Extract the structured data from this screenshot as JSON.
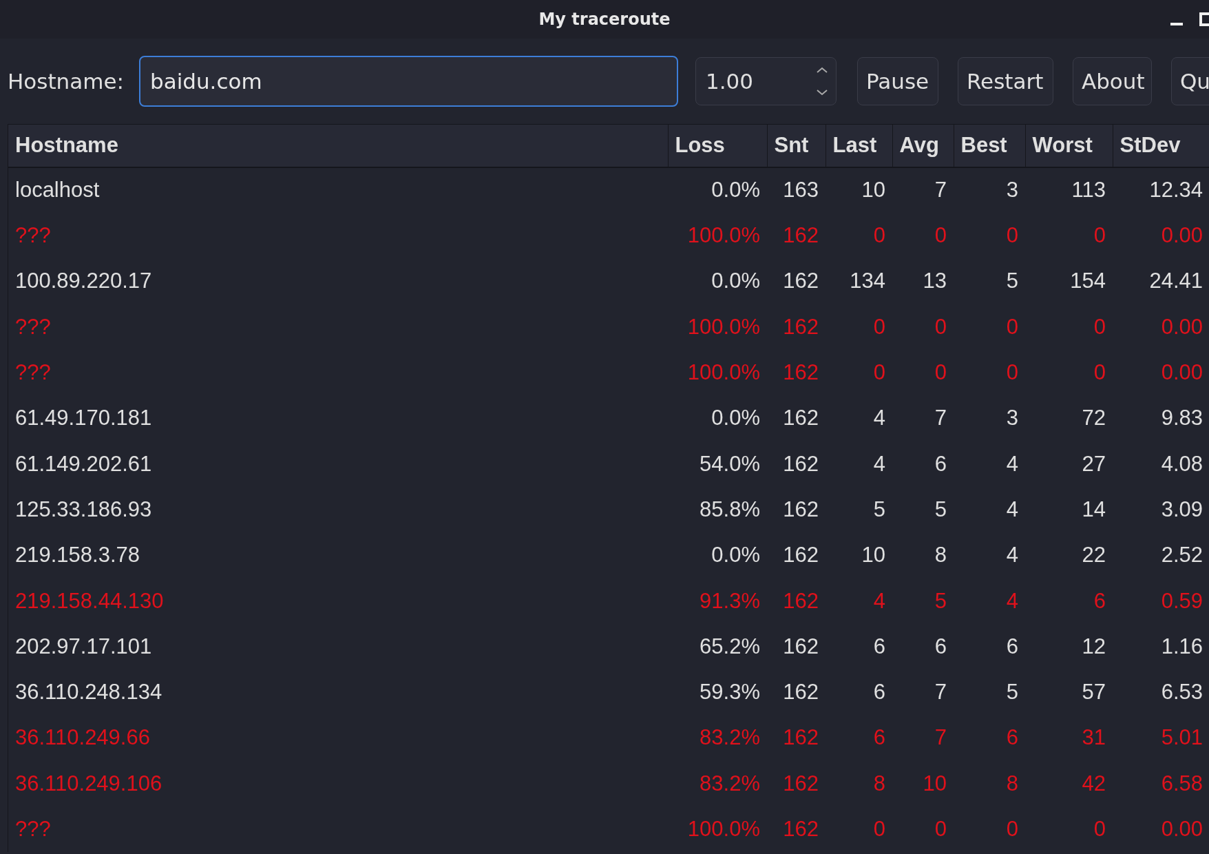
{
  "window": {
    "title": "My traceroute"
  },
  "toolbar": {
    "hostname_label": "Hostname:",
    "hostname_value": "baidu.com",
    "interval_value": "1.00",
    "buttons": [
      "Pause",
      "Restart",
      "About",
      "Qu"
    ]
  },
  "table": {
    "columns": [
      "Hostname",
      "Loss",
      "Snt",
      "Last",
      "Avg",
      "Best",
      "Worst",
      "StDev"
    ],
    "rows": [
      {
        "alert": false,
        "cells": [
          "localhost",
          "0.0%",
          "163",
          "10",
          "7",
          "3",
          "113",
          "12.34"
        ]
      },
      {
        "alert": true,
        "cells": [
          "???",
          "100.0%",
          "162",
          "0",
          "0",
          "0",
          "0",
          "0.00"
        ]
      },
      {
        "alert": false,
        "cells": [
          "100.89.220.17",
          "0.0%",
          "162",
          "134",
          "13",
          "5",
          "154",
          "24.41"
        ]
      },
      {
        "alert": true,
        "cells": [
          "???",
          "100.0%",
          "162",
          "0",
          "0",
          "0",
          "0",
          "0.00"
        ]
      },
      {
        "alert": true,
        "cells": [
          "???",
          "100.0%",
          "162",
          "0",
          "0",
          "0",
          "0",
          "0.00"
        ]
      },
      {
        "alert": false,
        "cells": [
          "61.49.170.181",
          "0.0%",
          "162",
          "4",
          "7",
          "3",
          "72",
          "9.83"
        ]
      },
      {
        "alert": false,
        "cells": [
          "61.149.202.61",
          "54.0%",
          "162",
          "4",
          "6",
          "4",
          "27",
          "4.08"
        ]
      },
      {
        "alert": false,
        "cells": [
          "125.33.186.93",
          "85.8%",
          "162",
          "5",
          "5",
          "4",
          "14",
          "3.09"
        ]
      },
      {
        "alert": false,
        "cells": [
          "219.158.3.78",
          "0.0%",
          "162",
          "10",
          "8",
          "4",
          "22",
          "2.52"
        ]
      },
      {
        "alert": true,
        "cells": [
          "219.158.44.130",
          "91.3%",
          "162",
          "4",
          "5",
          "4",
          "6",
          "0.59"
        ]
      },
      {
        "alert": false,
        "cells": [
          "202.97.17.101",
          "65.2%",
          "162",
          "6",
          "6",
          "6",
          "12",
          "1.16"
        ]
      },
      {
        "alert": false,
        "cells": [
          "36.110.248.134",
          "59.3%",
          "162",
          "6",
          "7",
          "5",
          "57",
          "6.53"
        ]
      },
      {
        "alert": true,
        "cells": [
          "36.110.249.66",
          "83.2%",
          "162",
          "6",
          "7",
          "6",
          "31",
          "5.01"
        ]
      },
      {
        "alert": true,
        "cells": [
          "36.110.249.106",
          "83.2%",
          "162",
          "8",
          "10",
          "8",
          "42",
          "6.58"
        ]
      },
      {
        "alert": true,
        "cells": [
          "???",
          "100.0%",
          "162",
          "0",
          "0",
          "0",
          "0",
          "0.00"
        ]
      }
    ]
  }
}
